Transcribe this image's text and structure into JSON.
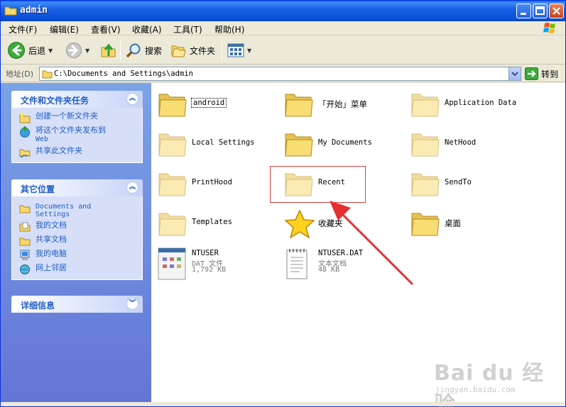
{
  "window": {
    "title": "admin"
  },
  "menu": [
    {
      "label": "文件(F)"
    },
    {
      "label": "编辑(E)"
    },
    {
      "label": "查看(V)"
    },
    {
      "label": "收藏(A)"
    },
    {
      "label": "工具(T)"
    },
    {
      "label": "帮助(H)"
    }
  ],
  "toolbar": {
    "back_label": "后退",
    "search_label": "搜索",
    "folders_label": "文件夹"
  },
  "address": {
    "label": "地址(D)",
    "value": "C:\\Documents and Settings\\admin",
    "go_label": "转到"
  },
  "tasks_panel": {
    "title": "文件和文件夹任务",
    "items": [
      {
        "label": "创建一个新文件夹",
        "icon": "new-folder-icon"
      },
      {
        "label_line1": "将这个文件夹发布到",
        "label_line2": "Web",
        "icon": "publish-web-icon"
      },
      {
        "label": "共享此文件夹",
        "icon": "share-folder-icon"
      }
    ]
  },
  "places_panel": {
    "title": "其它位置",
    "items": [
      {
        "label_line1": "Documents and",
        "label_line2": "Settings",
        "icon": "folder-icon"
      },
      {
        "label": "我的文档",
        "icon": "my-documents-icon"
      },
      {
        "label": "共享文档",
        "icon": "shared-documents-icon"
      },
      {
        "label": "我的电脑",
        "icon": "my-computer-icon"
      },
      {
        "label": "网上邻居",
        "icon": "network-places-icon"
      }
    ]
  },
  "details_panel": {
    "title": "详细信息"
  },
  "files": [
    {
      "name": "android",
      "type": "folder"
    },
    {
      "name": "「开始」菜单",
      "type": "folder"
    },
    {
      "name": "Application Data",
      "type": "folder-faded"
    },
    {
      "name": "Local Settings",
      "type": "folder-faded"
    },
    {
      "name": "My Documents",
      "type": "folder"
    },
    {
      "name": "NetHood",
      "type": "folder-faded"
    },
    {
      "name": "PrintHood",
      "type": "folder-faded"
    },
    {
      "name": "Recent",
      "type": "folder-faded"
    },
    {
      "name": "SendTo",
      "type": "folder-faded"
    },
    {
      "name": "Templates",
      "type": "folder-faded"
    },
    {
      "name": "收藏夹",
      "type": "favorites"
    },
    {
      "name": "桌面",
      "type": "folder"
    },
    {
      "name": "NTUSER",
      "type": "dat",
      "meta1": "DAT 文件",
      "meta2": "1,792 KB"
    },
    {
      "name": "NTUSER.DAT",
      "type": "text",
      "meta1": "文本文档",
      "meta2": "48 KB"
    }
  ],
  "watermark": {
    "brand": "Bai du 经验",
    "url": "jingyan.baidu.com"
  },
  "colors": {
    "accent": "#215dc6",
    "titlebar": "#0a4fd6",
    "highlight": "#e03c3c"
  }
}
